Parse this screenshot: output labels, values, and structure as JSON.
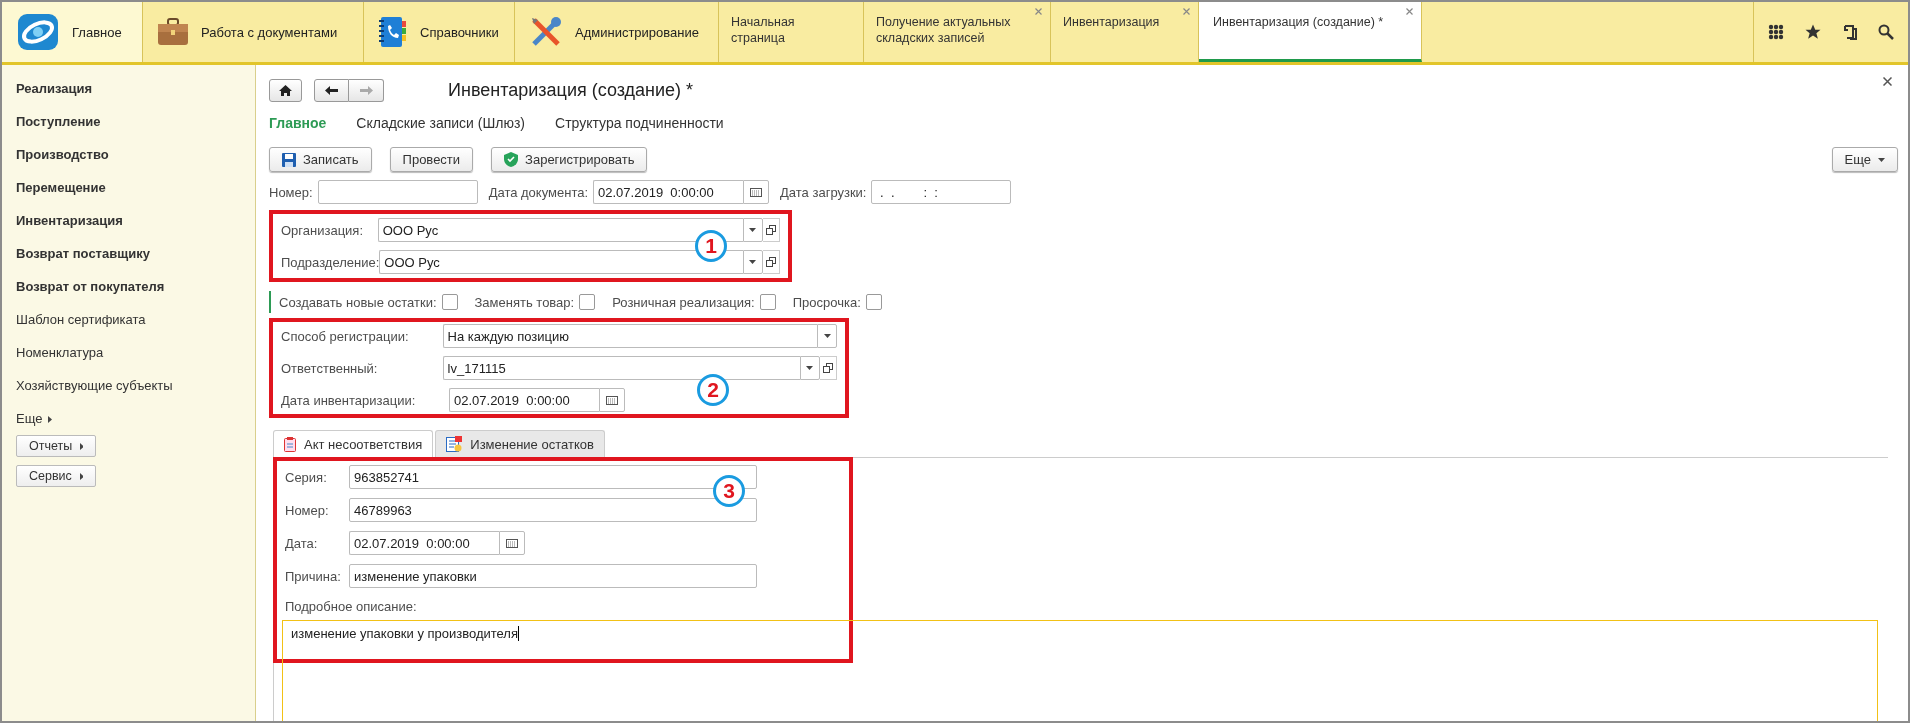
{
  "sections": [
    {
      "label": "Главное",
      "kind": "home",
      "selected": true
    },
    {
      "label": "Работа с документами",
      "kind": "documents",
      "selected": false
    },
    {
      "label": "Справочники",
      "kind": "catalogs",
      "selected": false
    },
    {
      "label": "Администрирование",
      "kind": "admin",
      "selected": false
    }
  ],
  "open_tabs": [
    {
      "label": "Начальная страница",
      "closable": false,
      "selected": false
    },
    {
      "label": "Получение актуальных складских записей",
      "closable": true,
      "selected": false
    },
    {
      "label": "Инвентаризация",
      "closable": true,
      "selected": false
    },
    {
      "label": "Инвентаризация (создание) *",
      "closable": true,
      "selected": true
    }
  ],
  "sidebar": {
    "items": [
      {
        "label": "Реализация",
        "kind": "section"
      },
      {
        "label": "Поступление",
        "kind": "section"
      },
      {
        "label": "Производство",
        "kind": "section"
      },
      {
        "label": "Перемещение",
        "kind": "section"
      },
      {
        "label": "Инвентаризация",
        "kind": "section"
      },
      {
        "label": "Возврат поставщику",
        "kind": "section"
      },
      {
        "label": "Возврат от покупателя",
        "kind": "section"
      },
      {
        "label": "Шаблон сертификата",
        "kind": "command"
      },
      {
        "label": "Номенклатура",
        "kind": "command"
      },
      {
        "label": "Хозяйствующие субъекты",
        "kind": "command"
      }
    ],
    "more": "Еще",
    "buttons": [
      "Отчеты",
      "Сервис"
    ]
  },
  "form": {
    "title": "Инвентаризация (создание) *",
    "tabs": [
      {
        "label": "Главное",
        "selected": true
      },
      {
        "label": "Складские записи (Шлюз)",
        "selected": false
      },
      {
        "label": "Структура подчиненности",
        "selected": false
      }
    ],
    "buttons": [
      {
        "label": "Записать",
        "kind": "save"
      },
      {
        "label": "Провести",
        "kind": "post"
      },
      {
        "label": "Зарегистрировать",
        "kind": "register"
      }
    ],
    "more": "Еще",
    "header": [
      {
        "label": "Номер:",
        "kind": "text"
      },
      {
        "label": "Дата документа:",
        "value": "02.07.2019  0:00:00",
        "kind": "date"
      },
      {
        "label": "Дата загрузки:",
        "value": " .  .        :  :",
        "kind": "text"
      }
    ],
    "group_1": {
      "callout": "1",
      "fields": [
        {
          "label": "Организация:",
          "value": "ООО Рус",
          "kind": "ref"
        },
        {
          "label": "Подразделение:",
          "value": "ООО Рус",
          "kind": "ref"
        }
      ]
    },
    "checkboxes": [
      {
        "label": "Создавать новые остатки:",
        "checked": false
      },
      {
        "label": "Заменять товар:",
        "checked": false
      },
      {
        "label": "Розничная реализация:",
        "checked": false
      },
      {
        "label": "Просрочка:",
        "checked": false
      }
    ],
    "group_2": {
      "callout": "2",
      "fields": [
        {
          "label": "Способ регистрации:",
          "value": "На каждую позицию",
          "kind": "select"
        },
        {
          "label": "Ответственный:",
          "value": "lv_171115",
          "kind": "ref"
        },
        {
          "label": "Дата инвентаризации:",
          "value": "02.07.2019  0:00:00",
          "kind": "date"
        }
      ]
    },
    "inner_tabs": [
      {
        "label": "Акт несоответствия",
        "kind": "act",
        "selected": true
      },
      {
        "label": "Изменение остатков",
        "kind": "changes",
        "selected": false
      }
    ],
    "group_3": {
      "callout": "3",
      "fields": [
        {
          "label": "Серия:",
          "value": "963852741",
          "kind": "text"
        },
        {
          "label": "Номер:",
          "value": "46789963",
          "kind": "text"
        },
        {
          "label": "Дата:",
          "value": "02.07.2019  0:00:00",
          "kind": "date"
        },
        {
          "label": "Причина:",
          "value": "изменение упаковки",
          "kind": "text"
        }
      ],
      "description_label": "Подробное описание:",
      "description": "изменение упаковки у производителя"
    }
  }
}
